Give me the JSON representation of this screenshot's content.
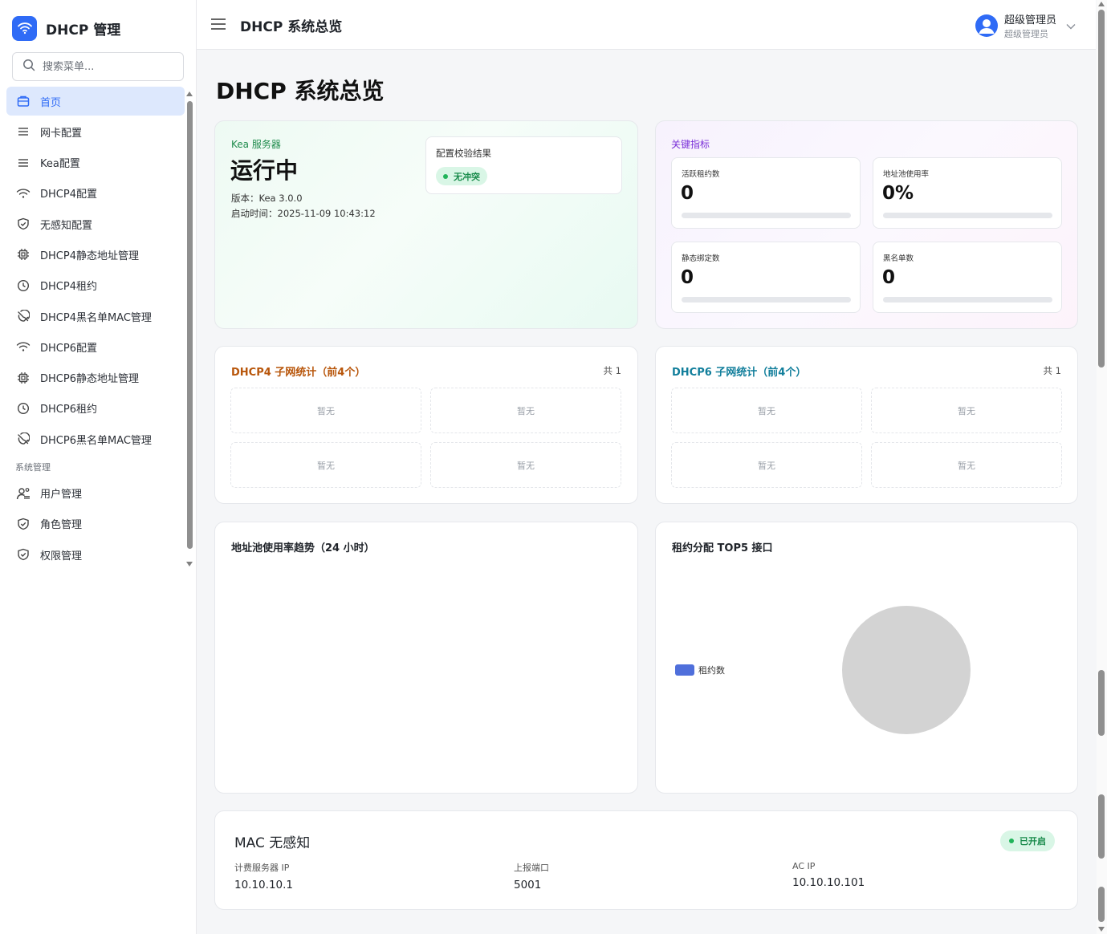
{
  "brand": {
    "title": "DHCP 管理",
    "color": "#2f6bf6"
  },
  "search": {
    "placeholder": "搜索菜单..."
  },
  "menu": {
    "items": [
      {
        "label": "首页",
        "icon": "home-icon",
        "active": true
      },
      {
        "label": "网卡配置",
        "icon": "list-icon"
      },
      {
        "label": "Kea配置",
        "icon": "list-icon"
      },
      {
        "label": "DHCP4配置",
        "icon": "wifi-icon"
      },
      {
        "label": "无感知配置",
        "icon": "shield-icon"
      },
      {
        "label": "DHCP4静态地址管理",
        "icon": "chip-icon"
      },
      {
        "label": "DHCP4租约",
        "icon": "clock-icon"
      },
      {
        "label": "DHCP4黑名单MAC管理",
        "icon": "block-icon"
      },
      {
        "label": "DHCP6配置",
        "icon": "wifi-icon"
      },
      {
        "label": "DHCP6静态地址管理",
        "icon": "chip-icon"
      },
      {
        "label": "DHCP6租约",
        "icon": "clock-icon"
      },
      {
        "label": "DHCP6黑名单MAC管理",
        "icon": "block-icon"
      }
    ],
    "group_label": "系统管理",
    "system_items": [
      {
        "label": "用户管理",
        "icon": "user-cog-icon"
      },
      {
        "label": "角色管理",
        "icon": "shield-icon"
      },
      {
        "label": "权限管理",
        "icon": "shield-icon"
      }
    ]
  },
  "header": {
    "title": "DHCP 系统总览",
    "user_name": "超级管理员",
    "user_role": "超级管理员"
  },
  "page": {
    "title": "DHCP 系统总览"
  },
  "kea": {
    "label": "Kea 服务器",
    "status": "运行中",
    "version": "版本：Kea 3.0.0",
    "start_time": "启动时间：2025-11-09 10:43:12",
    "config_check_title": "配置校验结果",
    "config_check_badge": "无冲突"
  },
  "kpi": {
    "label": "关键指标",
    "items": [
      {
        "name": "活跃租约数",
        "value": "0",
        "progress": 0
      },
      {
        "name": "地址池使用率",
        "value": "0%",
        "progress": 0
      },
      {
        "name": "静态绑定数",
        "value": "0",
        "progress": 0
      },
      {
        "name": "黑名单数",
        "value": "0",
        "progress": 0
      }
    ]
  },
  "subnet4": {
    "title": "DHCP4 子网统计（前4个）",
    "count": "共 1",
    "cells": [
      "暂无",
      "暂无",
      "暂无",
      "暂无"
    ]
  },
  "subnet6": {
    "title": "DHCP6 子网统计（前4个）",
    "count": "共 1",
    "cells": [
      "暂无",
      "暂无",
      "暂无",
      "暂无"
    ]
  },
  "trend": {
    "title": "地址池使用率趋势（24 小时）"
  },
  "top5": {
    "title": "租约分配 TOP5 接口",
    "legend": "租约数",
    "legend_color": "#4f6fdb",
    "empty_pie_color": "#d3d3d3"
  },
  "mac": {
    "title": "MAC 无感知",
    "badge": "已开启",
    "fields": [
      {
        "label": "计费服务器 IP",
        "value": "10.10.10.1"
      },
      {
        "label": "上报端口",
        "value": "5001"
      },
      {
        "label": "AC IP",
        "value": "10.10.10.101"
      }
    ]
  }
}
